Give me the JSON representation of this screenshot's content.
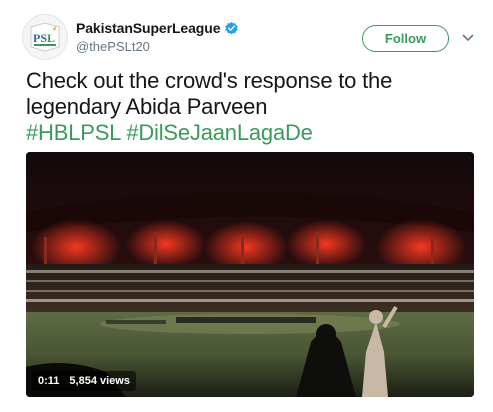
{
  "author": {
    "name": "PakistanSuperLeague",
    "handle": "@thePSLt20",
    "verified": true,
    "avatar_icon": "psl-logo-icon"
  },
  "actions": {
    "follow_label": "Follow",
    "menu_icon": "chevron-down-icon"
  },
  "tweet": {
    "text_line1": "Check out the crowd's response to the",
    "text_line2": "legendary Abida Parveen",
    "hashtag1": "#HBLPSL",
    "hashtag2": "#DilSeJaanLagaDe"
  },
  "video": {
    "duration": "0:11",
    "views": "5,854 views"
  },
  "colors": {
    "accent": "#3a9a5b",
    "verified": "#1da1f2",
    "text": "#14171a",
    "muted": "#657786"
  }
}
